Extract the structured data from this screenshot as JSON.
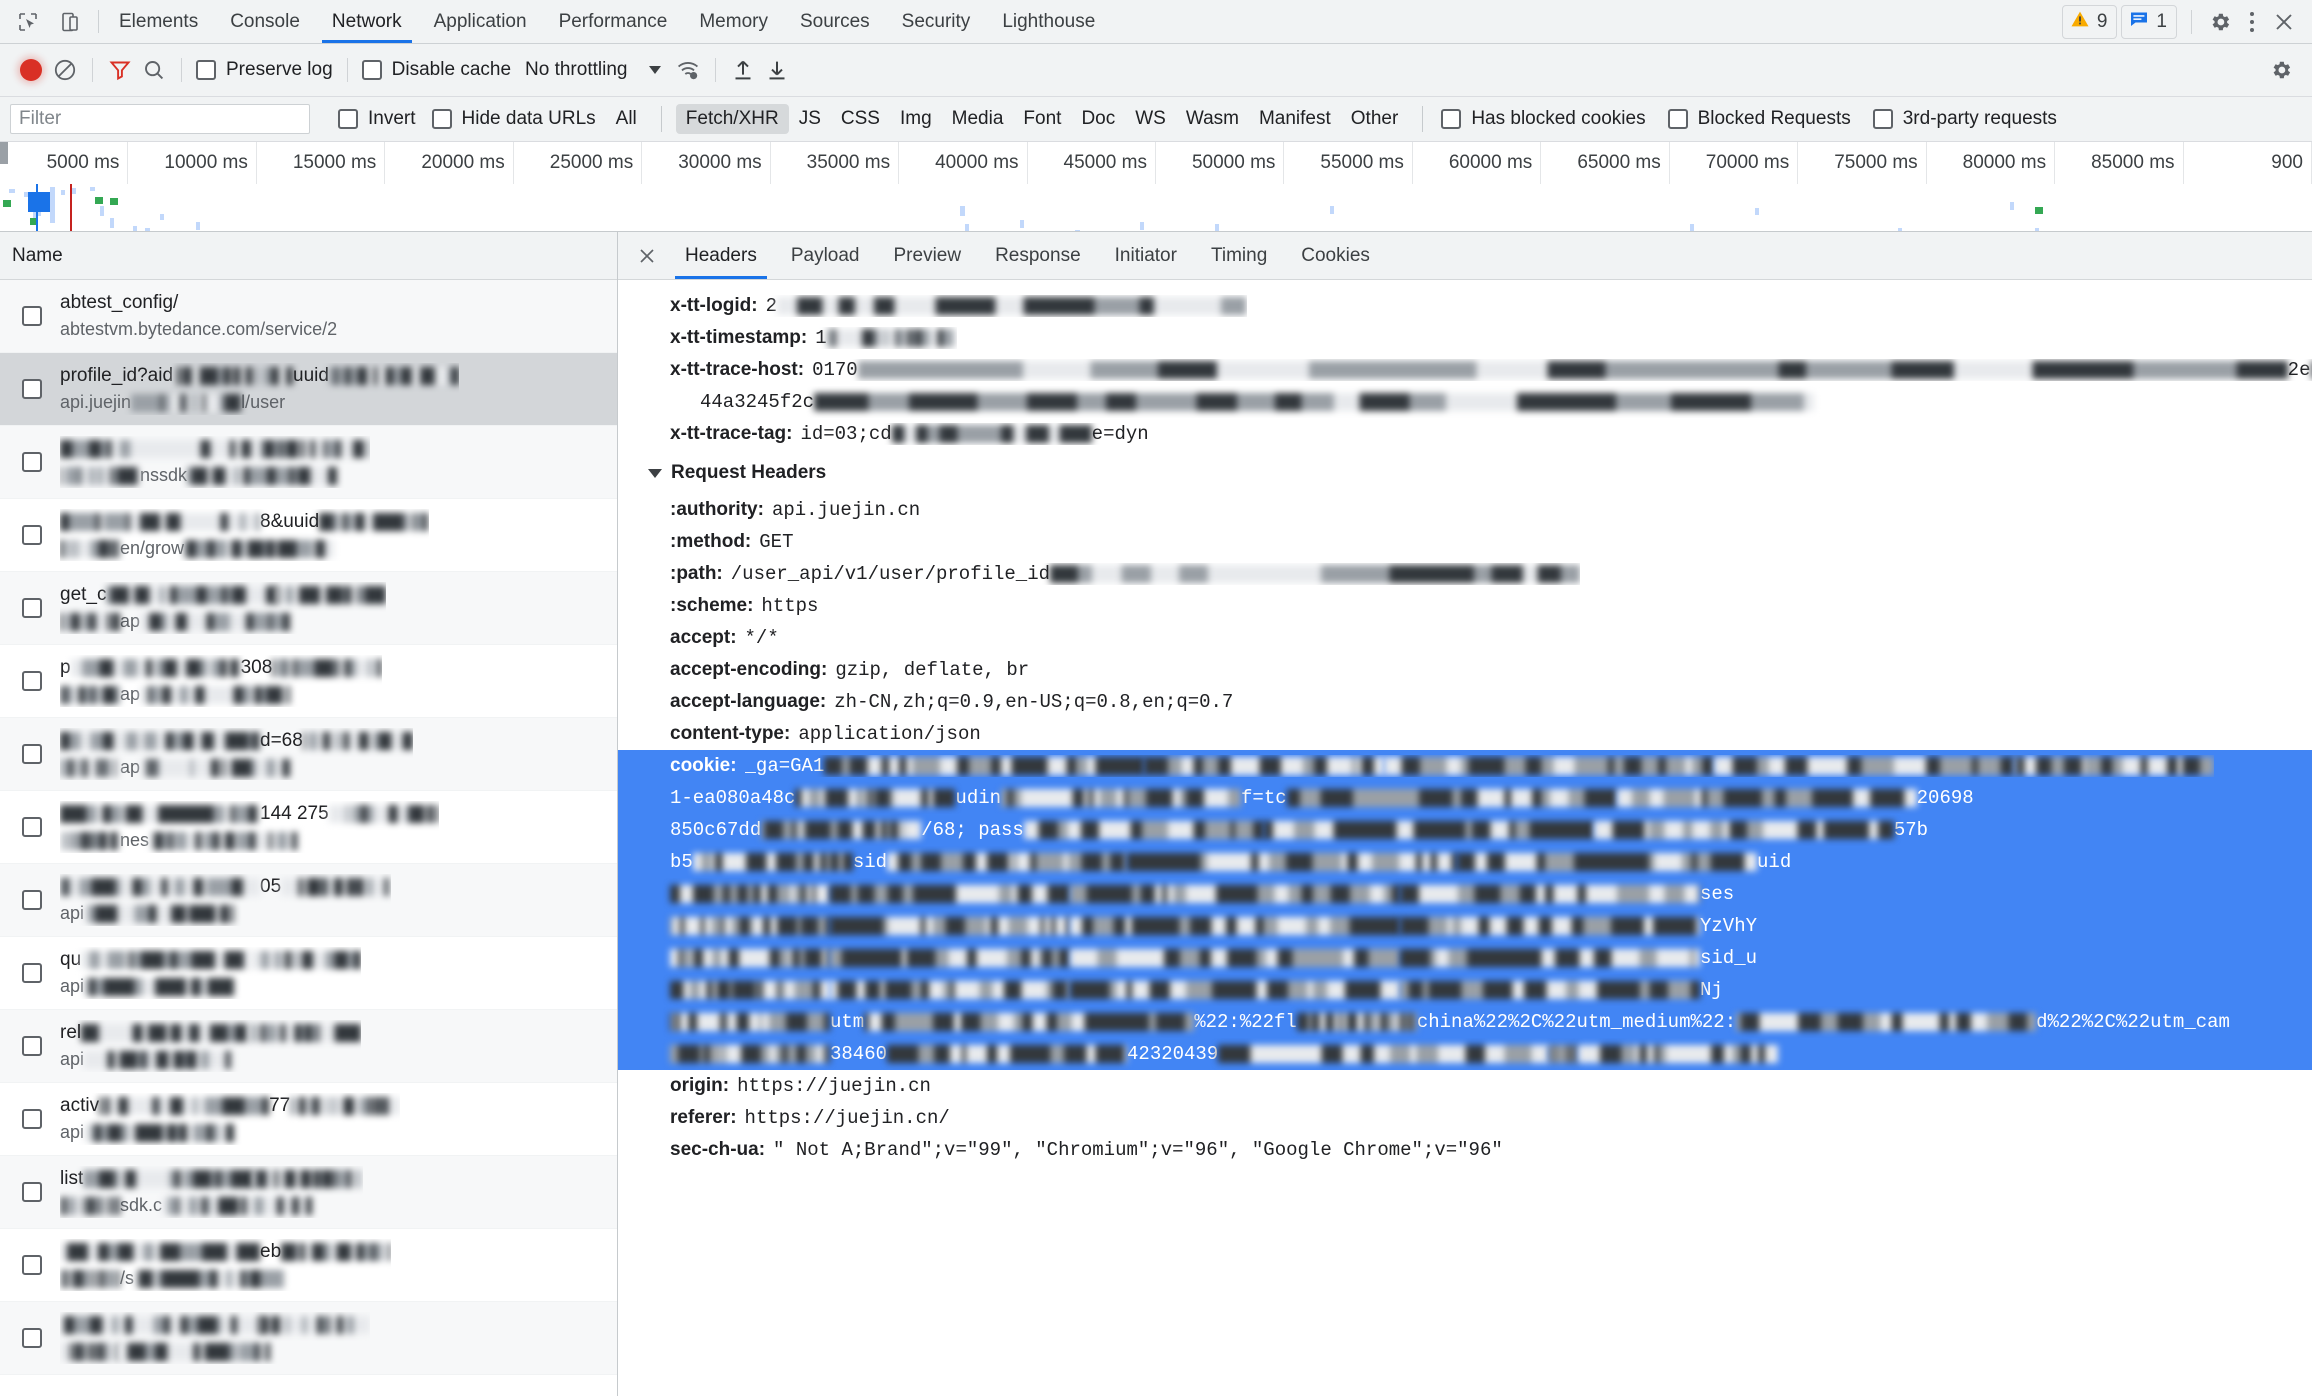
{
  "devtools": {
    "main_tabs": [
      {
        "label": "Elements",
        "active": false
      },
      {
        "label": "Console",
        "active": false
      },
      {
        "label": "Network",
        "active": true
      },
      {
        "label": "Application",
        "active": false
      },
      {
        "label": "Performance",
        "active": false
      },
      {
        "label": "Memory",
        "active": false
      },
      {
        "label": "Sources",
        "active": false
      },
      {
        "label": "Security",
        "active": false
      },
      {
        "label": "Lighthouse",
        "active": false
      }
    ],
    "warning_count": "9",
    "message_count": "1",
    "icons": {
      "inspect": "inspect-element-icon",
      "device": "device-toolbar-icon",
      "settings": "gear-icon",
      "more": "more-options-icon",
      "close": "close-icon"
    }
  },
  "network_toolbar": {
    "record_title": "record-button",
    "clear_title": "clear-button",
    "filter_title": "filter-button",
    "search_title": "search-button",
    "preserve_log": "Preserve log",
    "disable_cache": "Disable cache",
    "throttling": "No throttling",
    "wifi_title": "network-conditions-icon",
    "import_title": "import-har-icon",
    "export_title": "export-har-icon",
    "settings_title": "network-settings-icon"
  },
  "filter_bar": {
    "placeholder": "Filter",
    "value": "",
    "invert": "Invert",
    "hide_data_urls": "Hide data URLs",
    "types": [
      {
        "label": "All",
        "active": false
      },
      {
        "label": "Fetch/XHR",
        "active": true
      },
      {
        "label": "JS",
        "active": false
      },
      {
        "label": "CSS",
        "active": false
      },
      {
        "label": "Img",
        "active": false
      },
      {
        "label": "Media",
        "active": false
      },
      {
        "label": "Font",
        "active": false
      },
      {
        "label": "Doc",
        "active": false
      },
      {
        "label": "WS",
        "active": false
      },
      {
        "label": "Wasm",
        "active": false
      },
      {
        "label": "Manifest",
        "active": false
      },
      {
        "label": "Other",
        "active": false
      }
    ],
    "has_blocked_cookies": "Has blocked cookies",
    "blocked_requests": "Blocked Requests",
    "third_party_requests": "3rd-party requests"
  },
  "overview": {
    "ticks": [
      "5000 ms",
      "10000 ms",
      "15000 ms",
      "20000 ms",
      "25000 ms",
      "30000 ms",
      "35000 ms",
      "40000 ms",
      "45000 ms",
      "50000 ms",
      "55000 ms",
      "60000 ms",
      "65000 ms",
      "70000 ms",
      "75000 ms",
      "80000 ms",
      "85000 ms",
      "900"
    ],
    "dom_content_loaded_color": "#1a73e8",
    "load_color": "#c5221f",
    "request_marker_color": "#34a853"
  },
  "request_list": {
    "column_header": "Name",
    "rows": [
      {
        "name": "abtest_config/",
        "domain": "abtestvm.bytedance.com/service/2",
        "selected": false,
        "redact_name": 0,
        "redact_domain": 0
      },
      {
        "name": "profile_id?aid",
        "domain": "api.juejin",
        "selected": true,
        "redact_name": 1,
        "redact_domain": 1,
        "name_tail": "uuid",
        "domain_tail": "l/user"
      },
      {
        "name": "",
        "domain": "nssdk",
        "selected": false,
        "redact_name": 1,
        "redact_domain": 1
      },
      {
        "name": "",
        "domain": "en/grow",
        "selected": false,
        "redact_name": 1,
        "redact_domain": 1,
        "name_tail": "8&uuid"
      },
      {
        "name": "get_c",
        "domain": "ap",
        "selected": false,
        "redact_name": 1,
        "redact_domain": 1
      },
      {
        "name": "p",
        "domain": "ap",
        "selected": false,
        "redact_name": 1,
        "redact_domain": 1,
        "name_tail": "308"
      },
      {
        "name": "",
        "domain": "ap",
        "selected": false,
        "redact_name": 1,
        "redact_domain": 1,
        "name_tail": "d=68"
      },
      {
        "name": "",
        "domain": "nes",
        "selected": false,
        "redact_name": 1,
        "redact_domain": 1,
        "name_tail": "144    275"
      },
      {
        "name": "",
        "domain": "api",
        "selected": false,
        "redact_name": 1,
        "redact_domain": 1,
        "name_tail": "05"
      },
      {
        "name": "qu",
        "domain": "api",
        "selected": false,
        "redact_name": 1,
        "redact_domain": 1
      },
      {
        "name": "rel",
        "domain": "api",
        "selected": false,
        "redact_name": 1,
        "redact_domain": 1
      },
      {
        "name": "activ",
        "domain": "api",
        "selected": false,
        "redact_name": 1,
        "redact_domain": 1,
        "name_tail": "77"
      },
      {
        "name": "list",
        "domain": "sdk.c",
        "selected": false,
        "redact_name": 1,
        "redact_domain": 1
      },
      {
        "name": "",
        "domain": "/s",
        "selected": false,
        "redact_name": 1,
        "redact_domain": 1,
        "name_tail": "eb"
      },
      {
        "name": "",
        "domain": "",
        "selected": false,
        "redact_name": 1,
        "redact_domain": 1
      }
    ]
  },
  "detail_panel": {
    "close_icon": "close-icon",
    "tabs": [
      {
        "label": "Headers",
        "active": true
      },
      {
        "label": "Payload",
        "active": false
      },
      {
        "label": "Preview",
        "active": false
      },
      {
        "label": "Response",
        "active": false
      },
      {
        "label": "Initiator",
        "active": false
      },
      {
        "label": "Timing",
        "active": false
      },
      {
        "label": "Cookies",
        "active": false
      }
    ],
    "response_header_tail": [
      {
        "key": "x-tt-logid:",
        "value": "2",
        "redacted": true,
        "redact_w": 470
      },
      {
        "key": "x-tt-timestamp:",
        "value": "1",
        "redacted": true,
        "redact_w": 130
      },
      {
        "key": "x-tt-trace-host:",
        "value": "0170",
        "redacted": true,
        "redact_w": 1420,
        "tail": "2e",
        "tail2": "ebd"
      },
      {
        "continuation": "44a3245f2c",
        "redacted": true,
        "redact_w": 1000
      },
      {
        "key": "x-tt-trace-tag:",
        "value": "id=03;cd",
        "redacted": true,
        "redact_w": 180,
        "tail": "e=dyn"
      }
    ],
    "request_headers_label": "Request Headers",
    "request_headers": [
      {
        "key": ":authority:",
        "value": "api.juejin.cn"
      },
      {
        "key": ":method:",
        "value": "GET"
      },
      {
        "key": ":path:",
        "value": "/user_api/v1/user/profile_id",
        "redacted": true,
        "redact_w": 530
      },
      {
        "key": ":scheme:",
        "value": "https"
      },
      {
        "key": "accept:",
        "value": "*/*"
      },
      {
        "key": "accept-encoding:",
        "value": "gzip, deflate, br"
      },
      {
        "key": "accept-language:",
        "value": "zh-CN,zh;q=0.9,en-US;q=0.8,en;q=0.7"
      },
      {
        "key": "content-type:",
        "value": "application/json"
      }
    ],
    "cookie_header": {
      "key": "cookie:",
      "value_start": "_ga=GA1",
      "selected": true,
      "selection_color": "#4285f4",
      "lines": [
        {
          "prefix": "_ga=GA1",
          "redacted": true
        },
        {
          "prefix": "1-ea080a48c",
          "mid": "udin",
          "mid2": "f=tc",
          "redacted": true,
          "tail": "20698"
        },
        {
          "prefix": "850c67dd",
          "mid": "/68; pass",
          "redacted": true,
          "tail": "57b"
        },
        {
          "prefix": "b5",
          "mid": "sid",
          "redacted": true,
          "tail": "uid"
        },
        {
          "prefix": "",
          "redacted": true,
          "tail": "ses"
        },
        {
          "prefix": "",
          "redacted": true,
          "tail": "YzVhY"
        },
        {
          "prefix": "",
          "redacted": true,
          "tail": "sid_u"
        },
        {
          "prefix": "",
          "redacted": true,
          "tail": "Nj"
        },
        {
          "prefix": "",
          "mid": "utm",
          "mid2": "%22:%22fl",
          "mid3": "china%22%2C%22utm_medium%22:",
          "redacted": true,
          "tail": "d%22%2C%22utm_cam"
        },
        {
          "prefix": "",
          "mid": "38460",
          "mid2": "42320439",
          "redacted": true
        }
      ]
    },
    "trailing_headers": [
      {
        "key": "origin:",
        "value": "https://juejin.cn"
      },
      {
        "key": "referer:",
        "value": "https://juejin.cn/"
      },
      {
        "key": "sec-ch-ua:",
        "value": "\" Not A;Brand\";v=\"99\", \"Chromium\";v=\"96\", \"Google Chrome\";v=\"96\""
      }
    ]
  }
}
